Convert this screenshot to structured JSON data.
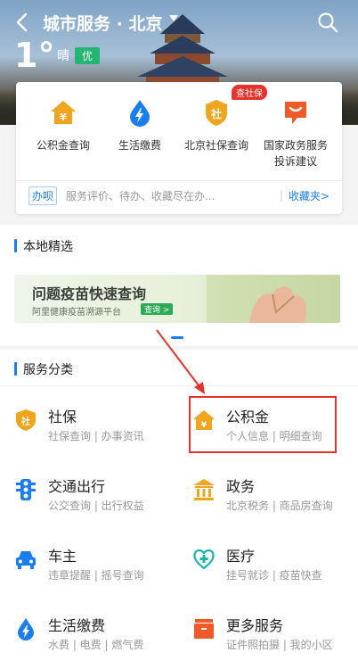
{
  "header": {
    "title": "城市服务 · 北京",
    "temperature": "1°",
    "weather": "晴",
    "aqi": "优"
  },
  "shortcuts": [
    {
      "label": "公积金查询",
      "icon": "house-yen-icon",
      "color": "#f0a51e"
    },
    {
      "label": "生活缴费",
      "icon": "water-bolt-icon",
      "color": "#1b7ef0"
    },
    {
      "label": "北京社保查询",
      "icon": "shield-she-icon",
      "color": "#f0a51e",
      "badge": "查社保"
    },
    {
      "label": "国家政务服务投诉建议",
      "label_line1": "国家政务服务",
      "label_line2": "投诉建议",
      "icon": "chat-bubble-icon",
      "color": "#f05a28"
    }
  ],
  "banji": {
    "tag": "办呗",
    "hint": "服务评价、待办、收藏尽在办...",
    "separator": "|",
    "favorites": "收藏夹>"
  },
  "local": {
    "section_title": "本地精选",
    "banner_title": "问题疫苗快速查询",
    "banner_sub": "阿里健康疫苗溯源平台",
    "banner_chip": "查询 >"
  },
  "services": {
    "section_title": "服务分类",
    "items": [
      {
        "name": "社保",
        "sub": "社保查询 | 办事资讯",
        "icon": "shield-she-icon"
      },
      {
        "name": "公积金",
        "sub": "个人信息 | 明细查询",
        "icon": "house-yen-icon"
      },
      {
        "name": "交通出行",
        "sub": "公交查询 | 出行权益",
        "icon": "traffic-light-icon"
      },
      {
        "name": "政务",
        "sub": "北京税务 | 商品房查询",
        "icon": "government-building-icon"
      },
      {
        "name": "车主",
        "sub": "违章提醒 | 摇号查询",
        "icon": "car-icon"
      },
      {
        "name": "医疗",
        "sub": "挂号就诊 | 疫苗快查",
        "icon": "medical-heart-icon"
      },
      {
        "name": "生活缴费",
        "sub": "水费 | 电费 | 燃气费",
        "icon": "water-bolt-icon"
      },
      {
        "name": "更多服务",
        "sub": "证件照拍摄 | 我的小区",
        "icon": "more-box-icon"
      }
    ]
  },
  "colors": {
    "accent": "#1b7ef0",
    "annotation": "#e8322c",
    "aqi_green": "#22b573"
  }
}
